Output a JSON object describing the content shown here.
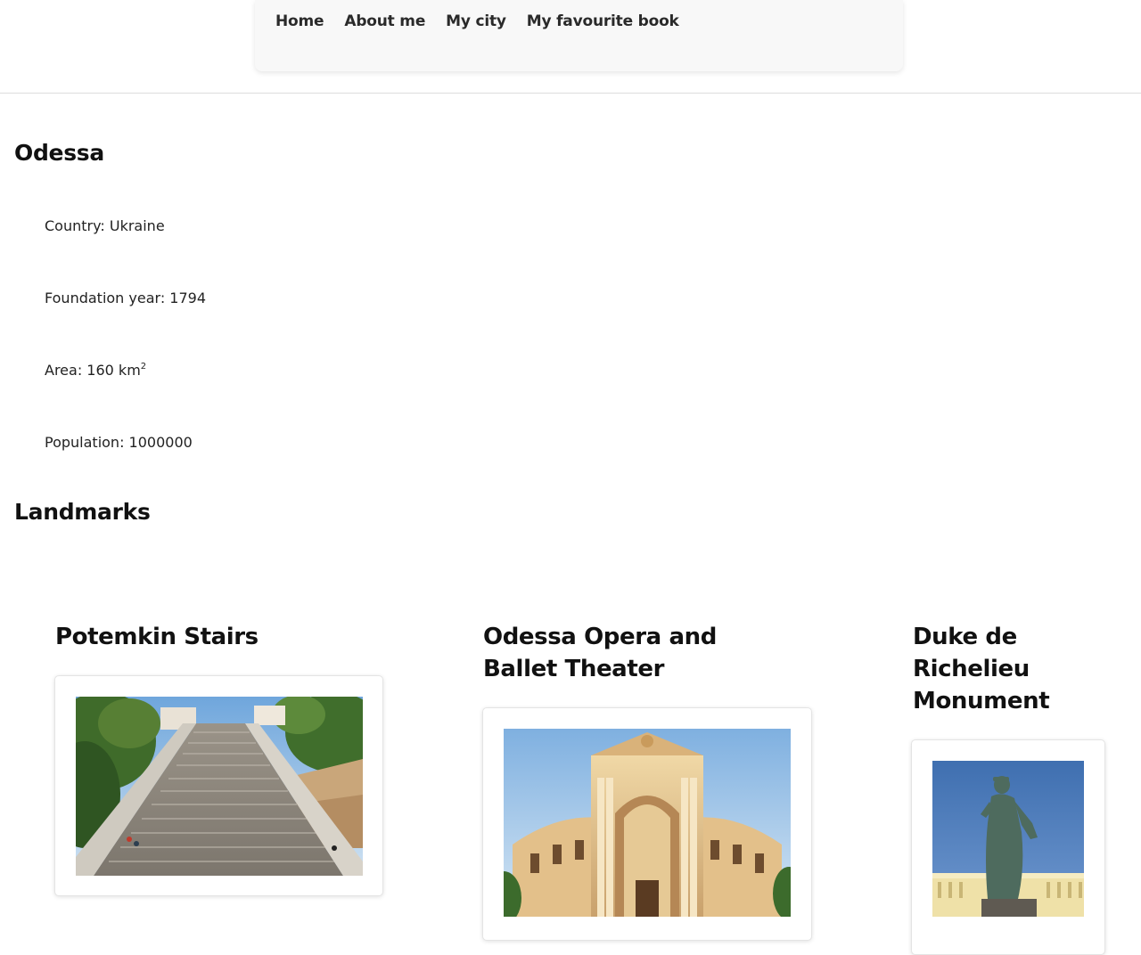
{
  "nav": {
    "items": [
      {
        "label": "Home"
      },
      {
        "label": "About me"
      },
      {
        "label": "My city"
      },
      {
        "label": "My favourite book"
      }
    ]
  },
  "city": {
    "title": "Odessa",
    "country": "Country: Ukraine",
    "foundation": "Foundation year: 1794",
    "area": "Area: 160 km",
    "area_sup": "2",
    "population": "Population: 1000000"
  },
  "landmarks": {
    "title": "Landmarks",
    "items": [
      {
        "name": "Potemkin Stairs",
        "image_icon": "stairs-photo"
      },
      {
        "name": "Odessa Opera and Ballet Theater",
        "image_icon": "opera-theater-photo"
      },
      {
        "name": "Duke de Richelieu Monument",
        "image_icon": "statue-photo"
      }
    ]
  }
}
